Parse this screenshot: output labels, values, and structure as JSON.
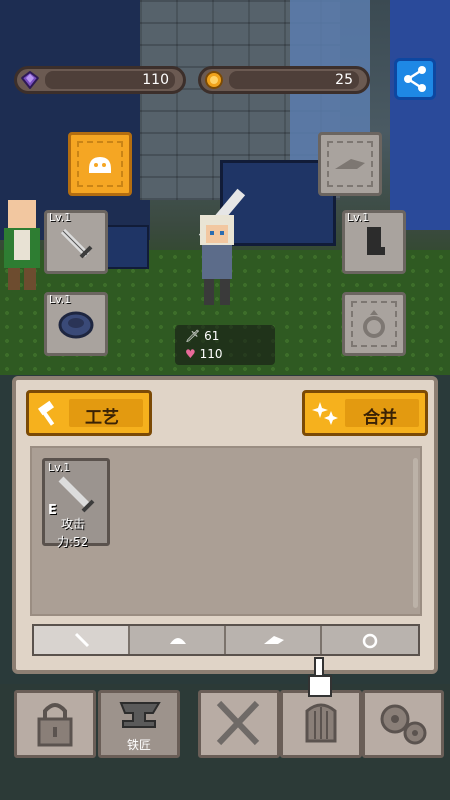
{
  "resources": {
    "gems": {
      "value": "110",
      "icon": "purple-gem-icon",
      "color": "#7a4fc2"
    },
    "coins": {
      "value": "25",
      "icon": "gold-coin-icon",
      "color": "#f0a21b"
    }
  },
  "equipment": {
    "left_slots": [
      {
        "level": "Lv.1",
        "item": "sword-icon"
      },
      {
        "level": "Lv.1",
        "item": "armor-icon"
      }
    ],
    "right_slots": [
      {
        "level": "",
        "item": "helmet-icon"
      },
      {
        "level": "Lv.1",
        "item": "boots-icon"
      },
      {
        "level": "",
        "item": "ring-icon"
      }
    ]
  },
  "hero_stats": {
    "attack": "61",
    "health": "110"
  },
  "panel": {
    "craft_label": "工艺",
    "merge_label": "合并",
    "inventory": [
      {
        "level": "Lv.1",
        "grade": "E",
        "stat_line1": "攻击",
        "stat_line2": "力:52"
      }
    ],
    "filter_tabs": [
      "sword-icon",
      "armor-icon",
      "helmet-icon",
      "ring-icon"
    ]
  },
  "bottom_nav": [
    {
      "icon": "lock-icon",
      "label": ""
    },
    {
      "icon": "anvil-icon",
      "label": "铁匠"
    },
    {
      "icon": "crossed-swords-icon",
      "label": ""
    },
    {
      "icon": "cage-icon",
      "label": ""
    },
    {
      "icon": "gears-icon",
      "label": ""
    }
  ],
  "colors": {
    "accent": "#f6b11d",
    "share": "#1e88e5"
  }
}
